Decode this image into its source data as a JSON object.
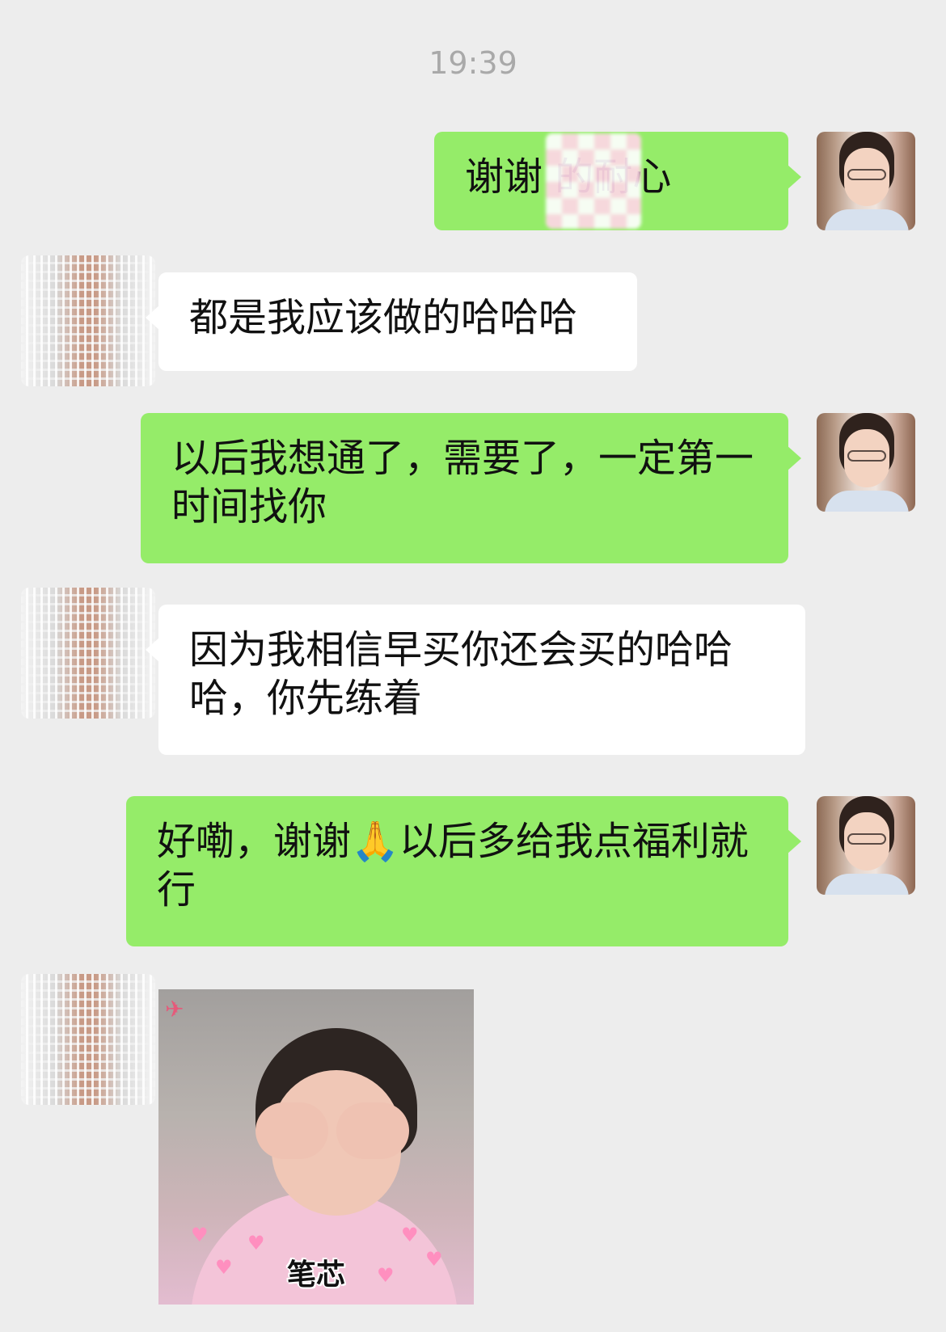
{
  "timestamp": "19:39",
  "messages": [
    {
      "sender": "me",
      "text": "谢谢 的耐心"
    },
    {
      "sender": "them",
      "text": "都是我应该做的哈哈哈"
    },
    {
      "sender": "me",
      "text": "以后我想通了，需要了，一定第一时间找你"
    },
    {
      "sender": "them",
      "text": "因为我相信早买你还会买的哈哈哈，你先练着"
    },
    {
      "sender": "me",
      "text": "好嘞，谢谢🙏以后多给我点福利就行"
    },
    {
      "sender": "them",
      "type": "sticker",
      "caption": "笔芯"
    }
  ],
  "colors": {
    "background": "#ededed",
    "my_bubble": "#95ec69",
    "their_bubble": "#ffffff",
    "timestamp_text": "#a9a9a9"
  }
}
